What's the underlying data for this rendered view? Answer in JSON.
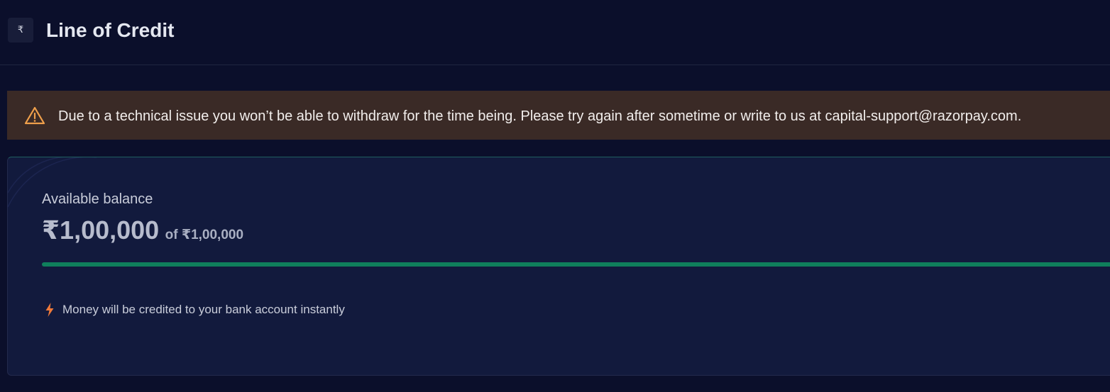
{
  "header": {
    "icon_glyph": "₹",
    "icon_name": "rupee-icon",
    "title": "Line of Credit"
  },
  "alert": {
    "icon_name": "warning-icon",
    "icon_color": "#f0a04b",
    "background": "#3a2a26",
    "message": "Due to a technical issue you won’t be able to withdraw for the time being. Please try again after sometime or write to us at capital-support@razorpay.com."
  },
  "balance": {
    "label": "Available balance",
    "amount": "₹1,00,000",
    "of_total": "of ₹1,00,000",
    "progress_fraction": 1.0,
    "progress_color": "#0f7f5c"
  },
  "info": {
    "icon_name": "lightning-bolt-icon",
    "icon_color": "#f07a3a",
    "text": "Money will be credited to your bank account instantly"
  }
}
